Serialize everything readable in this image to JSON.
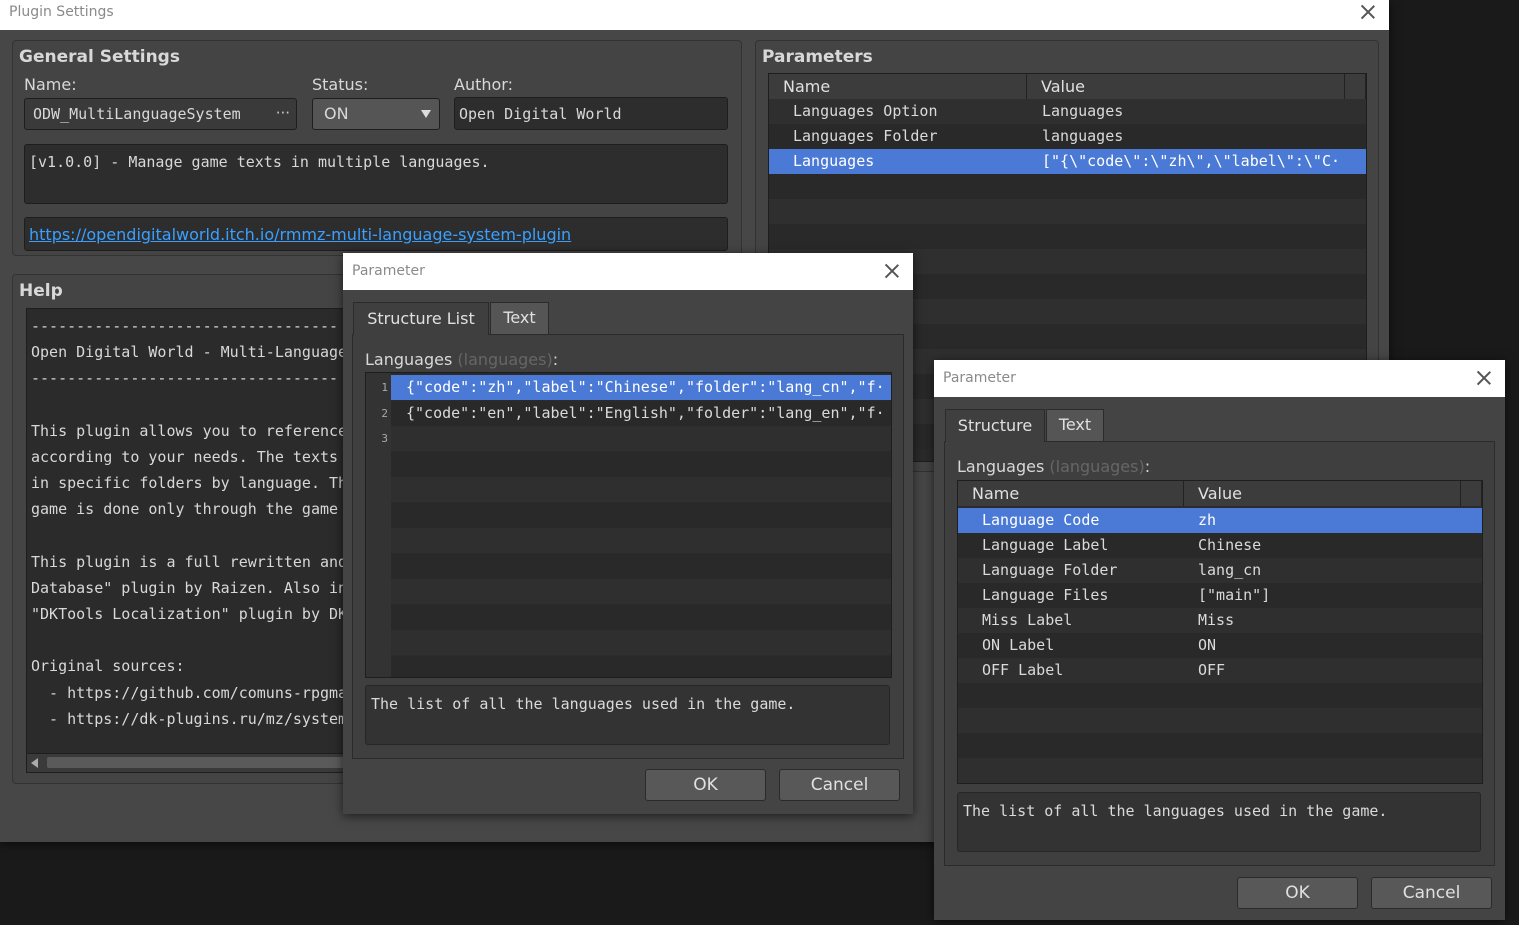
{
  "main": {
    "title": "Plugin Settings",
    "general": {
      "title": "General Settings",
      "name_label": "Name:",
      "name_value": "ODW_MultiLanguageSystem",
      "name_button": "···",
      "status_label": "Status:",
      "status_value": "ON",
      "author_label": "Author:",
      "author_value": "Open Digital World",
      "description": "[v1.0.0] - Manage game texts in multiple languages.",
      "url": "https://opendigitalworld.itch.io/rmmz-multi-language-system-plugin"
    },
    "help": {
      "title": "Help",
      "lines": [
        "----------------------------------",
        "Open Digital World - Multi-Language",
        "----------------------------------",
        "",
        "This plugin allows you to reference",
        "according to your needs. The texts a",
        "in specific folders by language. The",
        "game is done only through the game c",
        "",
        "This plugin is a full rewritten and",
        "Database\" plugin by Raizen. Also ins",
        "\"DKTools Localization\" plugin by DK.",
        "",
        "Original sources:",
        "  - https://github.com/comuns-rpgma",
        "  - https://dk-plugins.ru/mz/system"
      ]
    },
    "parameters": {
      "title": "Parameters",
      "col_name": "Name",
      "col_value": "Value",
      "rows": [
        {
          "name": "Languages Option",
          "value": "Languages"
        },
        {
          "name": "Languages Folder",
          "value": "languages"
        },
        {
          "name": "Languages",
          "value": "[\"{\\\"code\\\":\\\"zh\\\",\\\"label\\\":\\\"C···"
        }
      ]
    }
  },
  "dialog1": {
    "title": "Parameter",
    "tabs": [
      "Structure List",
      "Text"
    ],
    "param_label": "Languages",
    "param_key": "(languages)",
    "param_colon": ":",
    "items": [
      {
        "num": "1",
        "text": "{\"code\":\"zh\",\"label\":\"Chinese\",\"folder\":\"lang_cn\",\"f···"
      },
      {
        "num": "2",
        "text": "{\"code\":\"en\",\"label\":\"English\",\"folder\":\"lang_en\",\"f···"
      },
      {
        "num": "3",
        "text": ""
      }
    ],
    "description": "The list of all the languages used in the game.",
    "ok": "OK",
    "cancel": "Cancel"
  },
  "dialog2": {
    "title": "Parameter",
    "tabs": [
      "Structure",
      "Text"
    ],
    "param_label": "Languages",
    "param_key": "(languages)",
    "param_colon": ":",
    "col_name": "Name",
    "col_value": "Value",
    "rows": [
      {
        "name": "Language Code",
        "value": "zh"
      },
      {
        "name": "Language Label",
        "value": "Chinese"
      },
      {
        "name": "Language Folder",
        "value": "lang_cn"
      },
      {
        "name": "Language Files",
        "value": "[\"main\"]"
      },
      {
        "name": "Miss Label",
        "value": "Miss"
      },
      {
        "name": "ON Label",
        "value": "ON"
      },
      {
        "name": "OFF Label",
        "value": "OFF"
      }
    ],
    "description": "The list of all the languages used in the game.",
    "ok": "OK",
    "cancel": "Cancel"
  },
  "colors": {
    "selection": "#4a7ad6",
    "link": "#3aa0ff",
    "window_bg": "#474747"
  }
}
